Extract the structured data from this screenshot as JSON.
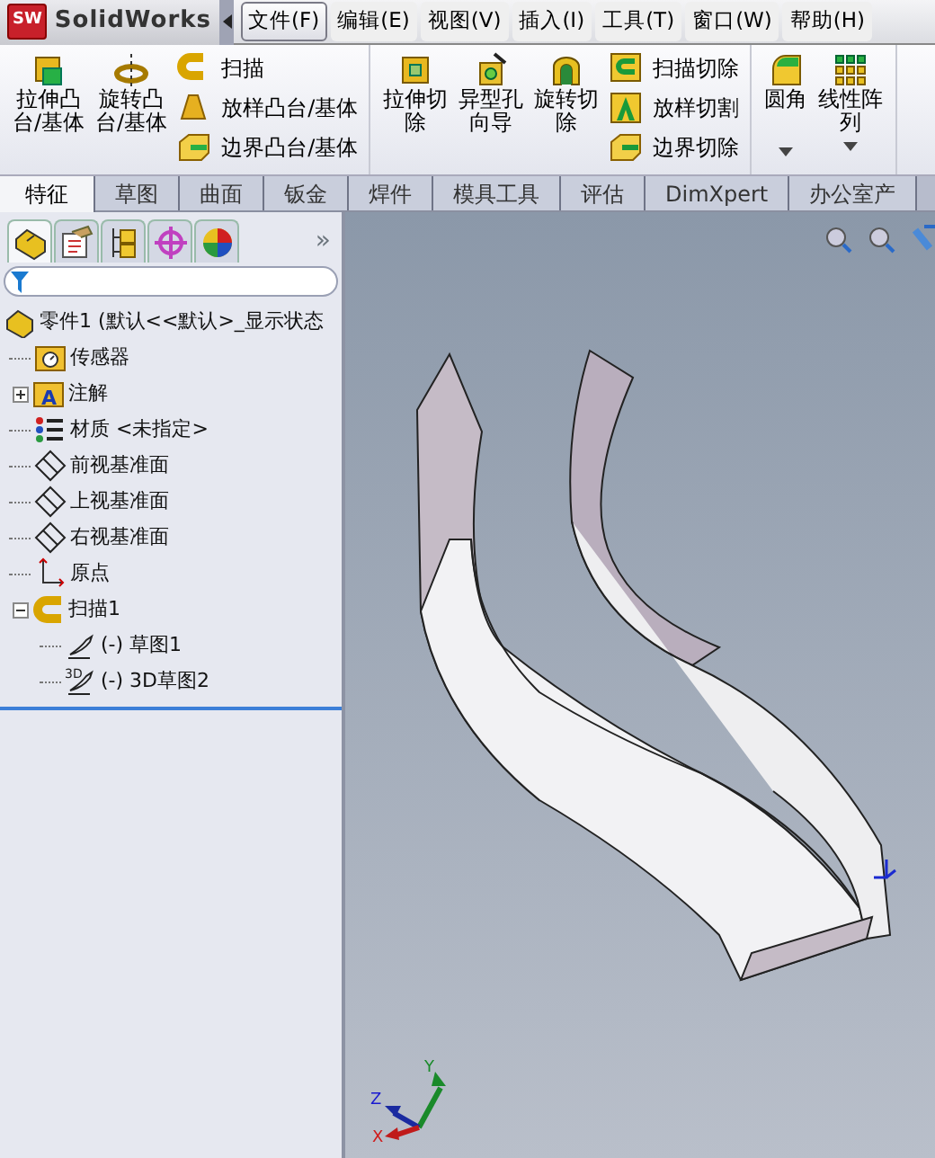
{
  "app": {
    "logo_text": "SolidWorks",
    "logo_badge": "SW"
  },
  "menu": [
    {
      "label": "文件(F)",
      "selected": true
    },
    {
      "label": "编辑(E)",
      "selected": false
    },
    {
      "label": "视图(V)",
      "selected": false
    },
    {
      "label": "插入(I)",
      "selected": false
    },
    {
      "label": "工具(T)",
      "selected": false
    },
    {
      "label": "窗口(W)",
      "selected": false
    },
    {
      "label": "帮助(H)",
      "selected": false
    }
  ],
  "toolbar": [
    [
      {
        "kind": "large",
        "lines": [
          "拉伸凸",
          "台/基体"
        ]
      },
      {
        "kind": "large",
        "lines": [
          "旋转凸",
          "台/基体"
        ]
      },
      {
        "kind": "stack",
        "items": [
          "扫描",
          "放样凸台/基体",
          "边界凸台/基体"
        ]
      }
    ],
    [
      {
        "kind": "large",
        "lines": [
          "拉伸切",
          "除"
        ]
      },
      {
        "kind": "large",
        "lines": [
          "异型孔",
          "向导"
        ]
      },
      {
        "kind": "large",
        "lines": [
          "旋转切",
          "除"
        ]
      },
      {
        "kind": "stack",
        "items": [
          "扫描切除",
          "放样切割",
          "边界切除"
        ]
      }
    ],
    [
      {
        "kind": "large",
        "lines": [
          "圆角"
        ],
        "dropdown": true
      },
      {
        "kind": "large",
        "lines": [
          "线性阵",
          "列"
        ],
        "dropdown": true
      }
    ]
  ],
  "tabs": [
    {
      "label": "特征",
      "selected": true
    },
    {
      "label": "草图",
      "selected": false
    },
    {
      "label": "曲面",
      "selected": false
    },
    {
      "label": "钣金",
      "selected": false
    },
    {
      "label": "焊件",
      "selected": false
    },
    {
      "label": "模具工具",
      "selected": false
    },
    {
      "label": "评估",
      "selected": false
    },
    {
      "label": "DimXpert",
      "selected": false
    },
    {
      "label": "办公室产",
      "selected": false
    }
  ],
  "panel_tabs": [
    {
      "selected": true
    },
    {
      "selected": false
    },
    {
      "selected": false
    },
    {
      "selected": false
    },
    {
      "selected": false
    }
  ],
  "panel_more": "»",
  "tree": {
    "label": "零件1  (默认<<默认>_显示状态",
    "kind": "part",
    "children": [
      {
        "label": "传感器",
        "kind": "sensor"
      },
      {
        "label": "注解",
        "kind": "annotation",
        "icon_text": "A",
        "expanded": false
      },
      {
        "label": "材质 <未指定>",
        "kind": "material"
      },
      {
        "label": "前视基准面",
        "kind": "plane"
      },
      {
        "label": "上视基准面",
        "kind": "plane"
      },
      {
        "label": "右视基准面",
        "kind": "plane"
      },
      {
        "label": "原点",
        "kind": "origin"
      },
      {
        "label": "扫描1",
        "kind": "sweep",
        "expanded": true,
        "children": [
          {
            "label": "(-) 草图1",
            "kind": "sketch"
          },
          {
            "label": "(-) 3D草图2",
            "kind": "sketch3d",
            "icon_text": "3D"
          }
        ]
      }
    ]
  },
  "triad": {
    "x": "X",
    "y": "Y",
    "z": "Z"
  }
}
